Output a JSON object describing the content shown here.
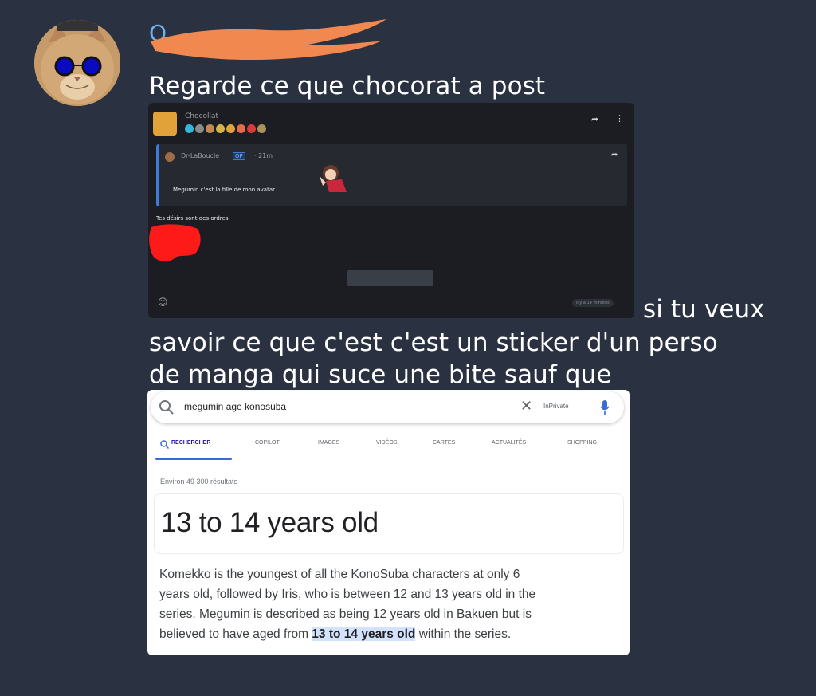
{
  "message": {
    "author_name_partial": "O",
    "lines": [
      "Regarde ce que chocorat a post",
      "si tu veux",
      "savoir ce que c'est c'est un sticker d'un perso",
      "de manga qui suce une bite sauf que"
    ]
  },
  "embed_post": {
    "author": "Chocollat",
    "quoted_author": "Dr-LaBoucle",
    "op_badge": "OP",
    "quoted_time": "· 21m",
    "quoted_text": "Megumin c'est la fille de mon avatar",
    "reply_text": "Tes désirs sont des ordres",
    "timestamp": "il y a 14 minutes"
  },
  "search_screenshot": {
    "query": "megumin age konosuba",
    "inprivate": "InPrivate",
    "tabs": [
      "RECHERCHER",
      "COPILOT",
      "IMAGES",
      "VIDÉOS",
      "CARTES",
      "ACTUALITÉS",
      "SHOPPING"
    ],
    "results_count": "Environ 49 300 résultats",
    "answer": "13 to 14 years old",
    "snippet_line1": "Komekko is the youngest of all the KonoSuba characters at only 6",
    "snippet_line2": "years old, followed by Iris, who is between 12 and 13 years old in the",
    "snippet_line3": "series. Megumin is described as being 12 years old in Bakuen but is",
    "snippet_line4_pre": "believed to have aged from ",
    "snippet_highlight": "13 to 14 years old",
    "snippet_line4_post": " within the series."
  },
  "colors": {
    "background": "#2a3241",
    "username": "#6ab2f2",
    "redaction": "#f0884f"
  }
}
